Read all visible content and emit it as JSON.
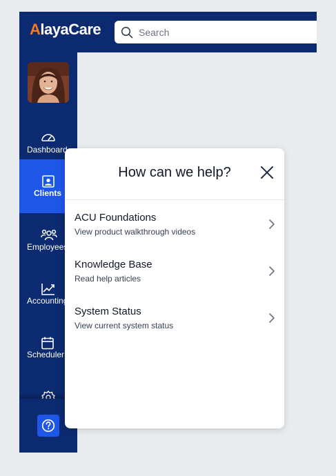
{
  "header": {
    "logo_prefix": "A",
    "logo_rest": "layaCare",
    "search_placeholder": "Search"
  },
  "sidebar": {
    "items": [
      {
        "label": "Dashboard",
        "icon": "dashboard-gauge-icon"
      },
      {
        "label": "Clients",
        "icon": "clients-id-card-icon",
        "active": true
      },
      {
        "label": "Employees",
        "icon": "employees-group-icon"
      },
      {
        "label": "Accounting",
        "icon": "accounting-chart-icon"
      },
      {
        "label": "Scheduler",
        "icon": "scheduler-calendar-icon"
      },
      {
        "label": "",
        "icon": "settings-gear-icon"
      }
    ],
    "help_icon": "help-question-icon"
  },
  "help_panel": {
    "title": "How can we help?",
    "close_icon": "close-icon",
    "items": [
      {
        "title": "ACU Foundations",
        "subtitle": "View product walkthrough videos"
      },
      {
        "title": "Knowledge Base",
        "subtitle": "Read help articles"
      },
      {
        "title": "System Status",
        "subtitle": "View current system status"
      }
    ]
  },
  "colors": {
    "nav_bg": "#0c2a70",
    "active_bg": "#1e56e8",
    "logo_accent": "#f47b20",
    "page_bg": "#e9ecef"
  }
}
